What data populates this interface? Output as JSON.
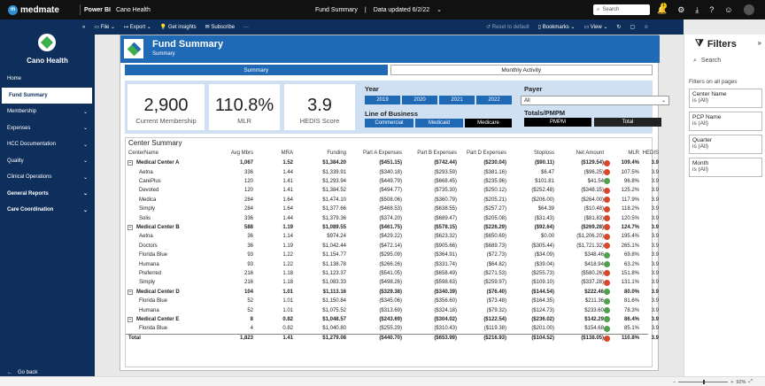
{
  "topbar": {
    "brand": "medmate",
    "product": "Power BI",
    "workspace": "Cano Health",
    "report": "Fund Summary",
    "updated": "Data updated 6/2/22",
    "search_placeholder": "Search",
    "notif_count": "1"
  },
  "sidebar": {
    "title": "Cano Health",
    "items": [
      {
        "label": "Home",
        "chev": ""
      },
      {
        "label": "Fund Summary",
        "chev": ""
      },
      {
        "label": "Membership",
        "chev": "⌄"
      },
      {
        "label": "Expenses",
        "chev": "⌄"
      },
      {
        "label": "HCC Documentation",
        "chev": "⌄"
      },
      {
        "label": "Quality",
        "chev": "⌄"
      },
      {
        "label": "Clinical Operations",
        "chev": "⌄"
      },
      {
        "label": "General Reports",
        "chev": "⌄"
      },
      {
        "label": "Care Coordination",
        "chev": "⌄"
      }
    ],
    "goback": "Go back"
  },
  "secbar": {
    "file": "File",
    "export": "Export",
    "insights": "Get insights",
    "subscribe": "Subscribe",
    "reset": "Reset to default",
    "bookmarks": "Bookmarks",
    "view": "View"
  },
  "report": {
    "title": "Fund Summary",
    "subtitle": "Summary",
    "tabs": [
      "Summary",
      "Monthly Activity"
    ]
  },
  "kpis": [
    {
      "value": "2,900",
      "label": "Current Membership"
    },
    {
      "value": "110.8%",
      "label": "MLR"
    },
    {
      "value": "3.9",
      "label": "HEDIS Score"
    }
  ],
  "slicers": {
    "year_label": "Year",
    "years": [
      "2019",
      "2020",
      "2021",
      "2022"
    ],
    "lob_label": "Line of Business",
    "lob": [
      "Commercial",
      "Medicaid",
      "Medicare"
    ],
    "payer_label": "Payer",
    "payer_value": "All",
    "totals_label": "Totals/PMPM",
    "totals": [
      "PMPM",
      "Total"
    ]
  },
  "table": {
    "title": "Center Summary",
    "headers": [
      "CenterName",
      "Avg Mbrs",
      "MRA",
      "Funding",
      "Part A Expenses",
      "Part B Expenses",
      "Part D Expenses",
      "Stoploss",
      "Net Amount",
      "MLR",
      "HEDIS"
    ],
    "rows": [
      {
        "type": "grp",
        "c": [
          "Medical Center A",
          "1,067",
          "1.52",
          "$1,384.20",
          "($451.15)",
          "($742.44)",
          "($230.04)",
          "($90.11)",
          "($129.54)",
          "109.4%",
          "3.9"
        ],
        "dot": "red"
      },
      {
        "type": "sub",
        "c": [
          "Aetna",
          "336",
          "1.44",
          "$1,339.91",
          "($340.18)",
          "($293.59)",
          "($381.16)",
          "$6.47",
          "($96.25)",
          "107.5%",
          "3.9"
        ],
        "dot": "red"
      },
      {
        "type": "sub",
        "c": [
          "CarePlus",
          "120",
          "1.41",
          "$1,293.94",
          "($449.79)",
          "($668.45)",
          "($235.96)",
          "$101.81",
          "$41.54",
          "96.8%",
          "3.9"
        ],
        "dot": "green"
      },
      {
        "type": "sub",
        "c": [
          "Devoted",
          "120",
          "1.41",
          "$1,384.52",
          "($494.77)",
          "($735.30)",
          "($250.12)",
          "($252.48)",
          "($348.15)",
          "125.2%",
          "3.9"
        ],
        "dot": "red"
      },
      {
        "type": "sub",
        "c": [
          "Medica",
          "284",
          "1.64",
          "$1,474.10",
          "($508.06)",
          "($360.79)",
          "($205.21)",
          "($206.00)",
          "($264.00)",
          "117.9%",
          "3.9"
        ],
        "dot": "red"
      },
      {
        "type": "sub",
        "c": [
          "Simply",
          "284",
          "1.64",
          "$1,377.66",
          "($468.53)",
          "($638.55)",
          "($257.27)",
          "$64.39",
          "($10.48)",
          "118.2%",
          "3.9"
        ],
        "dot": "red"
      },
      {
        "type": "sub",
        "c": [
          "Solis",
          "336",
          "1.44",
          "$1,379.36",
          "($374.20)",
          "($689.47)",
          "($205.08)",
          "($31.43)",
          "($81.83)",
          "120.5%",
          "3.9"
        ],
        "dot": "red"
      },
      {
        "type": "grp",
        "c": [
          "Medical Center B",
          "588",
          "1.19",
          "$1,089.55",
          "($461.75)",
          "($578.15)",
          "($226.29)",
          "($92.64)",
          "($269.28)",
          "124.7%",
          "3.9"
        ],
        "dot": "red"
      },
      {
        "type": "sub",
        "c": [
          "Aetna",
          "36",
          "1.14",
          "$974.24",
          "($429.22)",
          "($623.32)",
          "($650.69)",
          "$0.00",
          "($1,206.20)",
          "195.4%",
          "3.9"
        ],
        "dot": "red"
      },
      {
        "type": "sub",
        "c": [
          "Doctors",
          "36",
          "1.19",
          "$1,042.44",
          "($472.14)",
          "($905.66)",
          "($689.73)",
          "($305.44)",
          "($1,721.32)",
          "265.1%",
          "3.9"
        ],
        "dot": "red"
      },
      {
        "type": "sub",
        "c": [
          "Florida Blue",
          "93",
          "1.22",
          "$1,154.77",
          "($295.09)",
          "($364.91)",
          "($72.73)",
          "($34.09)",
          "$348.46",
          "69.8%",
          "3.9"
        ],
        "dot": "green"
      },
      {
        "type": "sub",
        "c": [
          "Humana",
          "93",
          "1.22",
          "$1,138.78",
          "($266.26)",
          "($331.74)",
          "($64.82)",
          "($39.04)",
          "$418.94",
          "63.2%",
          "3.9"
        ],
        "dot": "green"
      },
      {
        "type": "sub",
        "c": [
          "Preferred",
          "216",
          "1.18",
          "$1,123.37",
          "($541.05)",
          "($658.49)",
          "($271.53)",
          "($255.73)",
          "($580.26)",
          "151.8%",
          "3.9"
        ],
        "dot": "red"
      },
      {
        "type": "sub",
        "c": [
          "Simply",
          "216",
          "1.18",
          "$1,083.33",
          "($498.26)",
          "($598.63)",
          "($259.97)",
          "($109.10)",
          "($337.28)",
          "131.1%",
          "3.9"
        ],
        "dot": "red"
      },
      {
        "type": "grp",
        "c": [
          "Medical Center D",
          "104",
          "1.01",
          "$1,113.16",
          "($329.38)",
          "($340.39)",
          "($76.40)",
          "($144.54)",
          "$222.46",
          "80.0%",
          "3.9"
        ],
        "dot": "green"
      },
      {
        "type": "sub",
        "c": [
          "Florida Blue",
          "52",
          "1.01",
          "$1,150.84",
          "($345.06)",
          "($356.60)",
          "($73.48)",
          "($164.35)",
          "$211.36",
          "81.6%",
          "3.9"
        ],
        "dot": "green"
      },
      {
        "type": "sub",
        "c": [
          "Humana",
          "52",
          "1.01",
          "$1,075.52",
          "($313.69)",
          "($324.18)",
          "($79.32)",
          "($124.73)",
          "$233.60",
          "78.3%",
          "3.9"
        ],
        "dot": "green"
      },
      {
        "type": "grp",
        "c": [
          "Medical Center E",
          "8",
          "0.82",
          "$1,048.57",
          "($243.69)",
          "($304.02)",
          "($122.54)",
          "($236.02)",
          "$142.29",
          "86.4%",
          "3.9"
        ],
        "dot": "green"
      },
      {
        "type": "sub",
        "c": [
          "Florida Blue",
          "4",
          "0.82",
          "$1,040.80",
          "($255.29)",
          "($310.43)",
          "($119.38)",
          "($201.00)",
          "$154.68",
          "85.1%",
          "3.9"
        ],
        "dot": "green"
      },
      {
        "type": "total",
        "c": [
          "Total",
          "1,823",
          "1.41",
          "$1,279.08",
          "($440.70)",
          "($653.99)",
          "($216.93)",
          "($104.52)",
          "($138.05)",
          "110.8%",
          "3.9"
        ],
        "dot": "red"
      }
    ]
  },
  "filters": {
    "title": "Filters",
    "search": "Search",
    "section": "Filters on all pages",
    "cards": [
      {
        "name": "Center Name",
        "state": "is (All)"
      },
      {
        "name": "PCP Name",
        "state": "is (All)"
      },
      {
        "name": "Quarter",
        "state": "is (All)"
      },
      {
        "name": "Month",
        "state": "is (All)"
      }
    ]
  },
  "zoom": "92%",
  "colors": {
    "accent": "#1f69b5",
    "nav": "#0e2f5b",
    "red": "#d9472b",
    "green": "#4fa24c"
  }
}
